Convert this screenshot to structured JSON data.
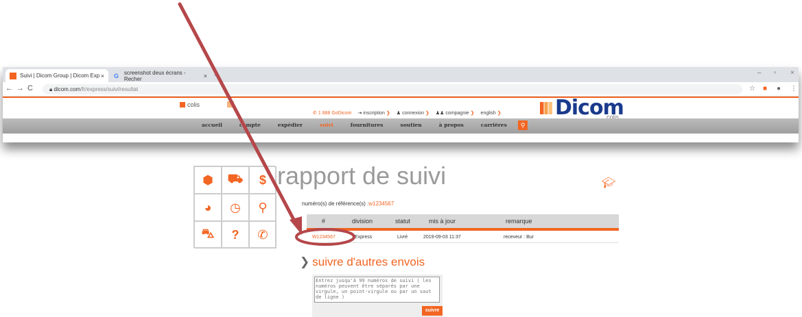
{
  "browser": {
    "tabs": [
      {
        "label": "Suivi | Dicom Group | Dicom Exp",
        "close": "×"
      },
      {
        "label": "screenshot deux écrans - Recher",
        "close": "×"
      }
    ],
    "new_tab": "+",
    "window_controls": {
      "minimize": "–",
      "restore": "▫",
      "close": "×"
    },
    "url_host": "dicom.com",
    "url_path": "/fr/express/suivi/resultat"
  },
  "site": {
    "colis_tab": "colis",
    "top_links": [
      {
        "icon": "phone-icon",
        "label": "1 888 GoDicom"
      },
      {
        "icon": "login-icon",
        "label": "inscription"
      },
      {
        "icon": "user-icon",
        "label": "connexion"
      },
      {
        "icon": "group-icon",
        "label": "compagnie"
      },
      {
        "icon": "",
        "label": "english"
      }
    ],
    "link_arrow": "❯",
    "logo_word": "Dicom",
    "logo_sub": "colis",
    "nav": [
      "accueil",
      "compte",
      "expédier",
      "suivi",
      "fournitures",
      "soutien",
      "à propos",
      "carrières"
    ],
    "active_nav": "suivi"
  },
  "page": {
    "title": "rapport de suivi",
    "ref_label": "numéro(s) de référence(s) :",
    "ref_value": "w1234567",
    "table": {
      "headers": [
        "#",
        "division",
        "statut",
        "mis à jour",
        "remarque"
      ],
      "rows": [
        {
          "number": "W1234567",
          "division": "Express",
          "statut": "Livré",
          "updated": "2019-09-03 11:37",
          "remark": "receveur : Bur"
        }
      ]
    },
    "follow_title": "suivre d'autres envois",
    "follow_placeholder": "Entrez jusqu'à 99 numéros de suivi ( les numéros peuvent être séparés par une virgule, un point-virgule ou par un saut de ligne )",
    "submit_label": "suivre"
  },
  "colors": {
    "accent": "#f26522",
    "brand": "#1a3a8c",
    "annotation": "#b5474a"
  }
}
